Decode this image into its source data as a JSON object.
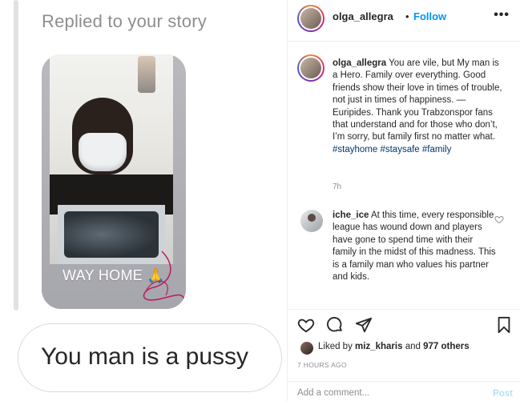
{
  "story_reply": {
    "heading": "Replied to your story",
    "story_overlay_text": "WAY HOME 🙏",
    "reply_message": "You man is a pussy"
  },
  "post": {
    "header": {
      "username": "olga_allegra",
      "separator": "•",
      "follow_label": "Follow",
      "more_icon": "more-options-icon"
    },
    "caption": {
      "username": "olga_allegra",
      "text": "You are vile, but My man is a Hero. Family over everything. Good friends show their love in times of trouble, not just in times of happiness. — Euripides. Thank you Trabzonspor fans that understand and for those who don’t, I’m sorry, but family first no matter what.",
      "hashtags": [
        "#stayhome",
        "#staysafe",
        "#family"
      ],
      "time": "7h"
    },
    "comments": [
      {
        "username": "iche_ice",
        "text": "At this time, every responsible league has wound down and players have gone to spend time with their family in the midst of this madness. This is a family man who values his partner and kids."
      }
    ],
    "actions": {
      "like_icon": "heart-icon",
      "comment_icon": "comment-icon",
      "share_icon": "share-icon",
      "save_icon": "bookmark-icon"
    },
    "likes": {
      "prefix": "Liked by",
      "user": "miz_kharis",
      "joiner": "and",
      "others": "977 others"
    },
    "timestamp": "7 HOURS AGO",
    "add_comment": {
      "placeholder": "Add a comment...",
      "post_label": "Post"
    }
  },
  "colors": {
    "link_blue": "#0095f6",
    "hashtag": "#00376b",
    "muted": "#8e8e8e",
    "post_disabled": "#b2dffc"
  }
}
